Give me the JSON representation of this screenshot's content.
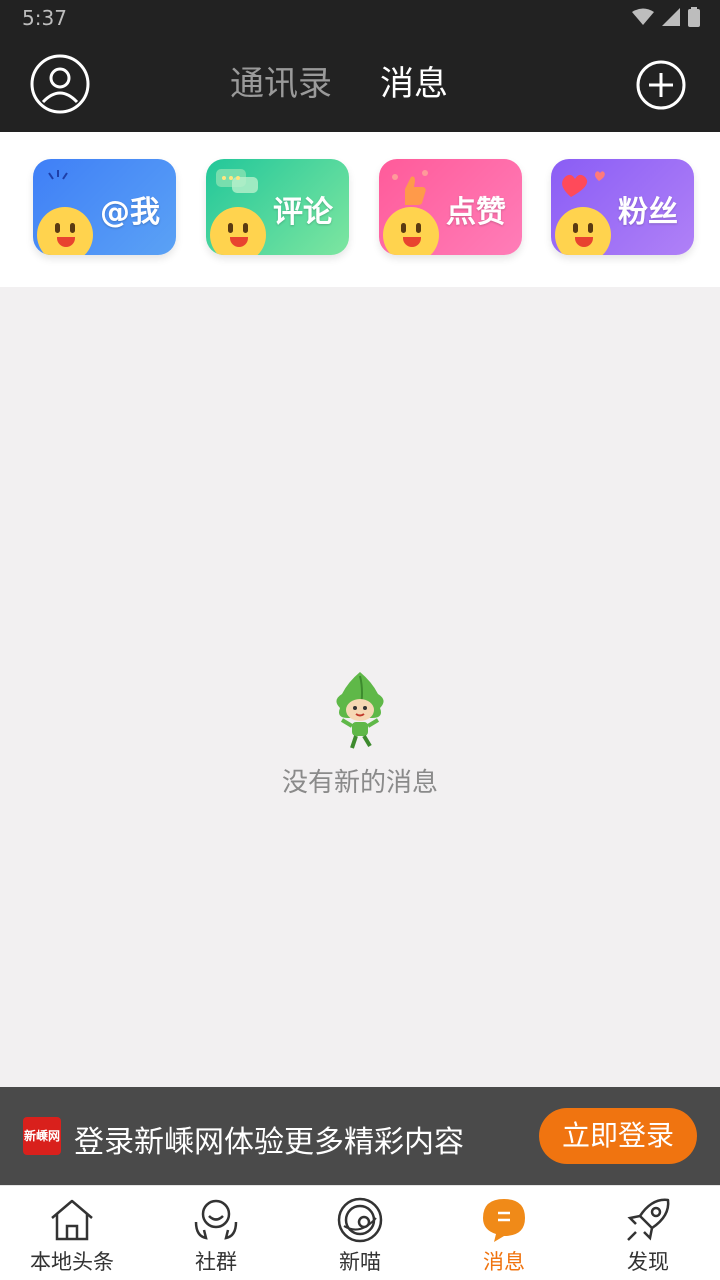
{
  "status_bar": {
    "time": "5:37"
  },
  "header": {
    "tabs": [
      {
        "label": "通讯录",
        "active": false
      },
      {
        "label": "消息",
        "active": true
      }
    ]
  },
  "quick_actions": [
    {
      "label": "@我",
      "color": "#3f7ff7"
    },
    {
      "label": "评论",
      "color": "#22c79a"
    },
    {
      "label": "点赞",
      "color": "#ff5b9a"
    },
    {
      "label": "粉丝",
      "color": "#8a5df5"
    }
  ],
  "empty_state": {
    "text": "没有新的消息"
  },
  "login_banner": {
    "logo_text": "新嵊网",
    "text": "登录新嵊网体验更多精彩内容",
    "button_label": "立即登录"
  },
  "bottom_nav": {
    "items": [
      {
        "label": "本地头条",
        "icon": "home-icon",
        "active": false
      },
      {
        "label": "社群",
        "icon": "community-icon",
        "active": false
      },
      {
        "label": "新喵",
        "icon": "planet-icon",
        "active": false
      },
      {
        "label": "消息",
        "icon": "message-icon",
        "active": true
      },
      {
        "label": "发现",
        "icon": "rocket-icon",
        "active": false
      }
    ]
  },
  "colors": {
    "accent": "#f07410",
    "header_bg": "#222222"
  }
}
